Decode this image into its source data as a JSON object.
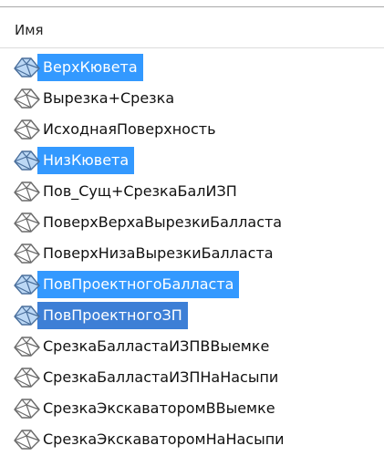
{
  "header": {
    "column_name": "Имя"
  },
  "colors": {
    "selection": "#3399ff",
    "text": "#111111",
    "icon_stroke": "#6a6a6a",
    "icon_fill_selected": "#bcd8f5"
  },
  "list": {
    "items": [
      {
        "label": "ВерхКювета",
        "selected": true,
        "icon": "surface-icon"
      },
      {
        "label": "Вырезка+Срезка",
        "selected": false,
        "icon": "surface-icon"
      },
      {
        "label": "ИсходнаяПоверхность",
        "selected": false,
        "icon": "surface-icon"
      },
      {
        "label": "НизКювета",
        "selected": true,
        "icon": "surface-icon"
      },
      {
        "label": "Пов_Сущ+СрезкаБалИЗП",
        "selected": false,
        "icon": "surface-icon"
      },
      {
        "label": "ПоверхВерхаВырезкиБалласта",
        "selected": false,
        "icon": "surface-icon"
      },
      {
        "label": "ПоверхНизаВырезкиБалласта",
        "selected": false,
        "icon": "surface-icon"
      },
      {
        "label": "ПовПроектногоБалласта",
        "selected": true,
        "icon": "surface-icon"
      },
      {
        "label": "ПовПроектногоЗП",
        "selected": true,
        "icon": "surface-icon"
      },
      {
        "label": "СрезкаБалластаИЗПВВыемке",
        "selected": false,
        "icon": "surface-icon"
      },
      {
        "label": "СрезкаБалластаИЗПНаНасыпи",
        "selected": false,
        "icon": "surface-icon"
      },
      {
        "label": "СрезкаЭкскаваторомВВыемке",
        "selected": false,
        "icon": "surface-icon"
      },
      {
        "label": "СрезкаЭкскаваторомНаНасыпи",
        "selected": false,
        "icon": "surface-icon"
      }
    ]
  }
}
